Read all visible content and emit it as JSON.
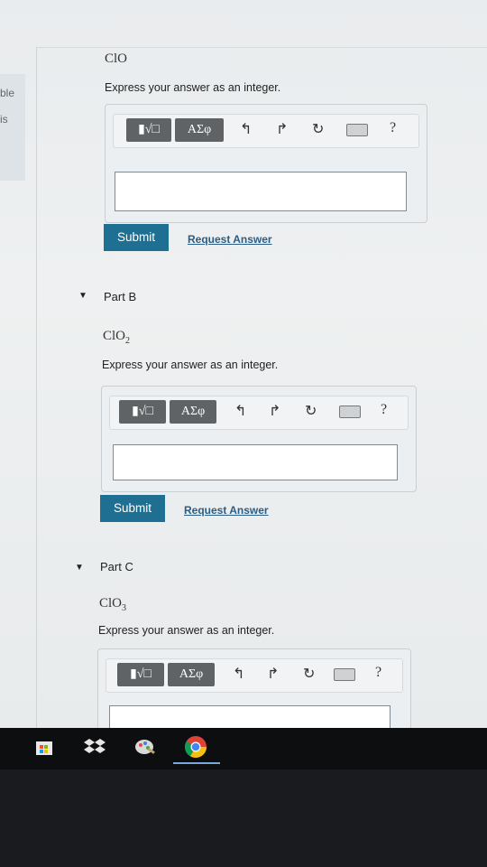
{
  "sidebar": {
    "text1": "ble",
    "text2": "is"
  },
  "parts": [
    {
      "id": "A",
      "title": "",
      "formula_main": "ClO",
      "formula_sub": "",
      "instruction": "Express your answer as an integer.",
      "submit_label": "Submit",
      "request_label": "Request Answer"
    },
    {
      "id": "B",
      "title": "Part B",
      "formula_main": "ClO",
      "formula_sub": "2",
      "instruction": "Express your answer as an integer.",
      "submit_label": "Submit",
      "request_label": "Request Answer"
    },
    {
      "id": "C",
      "title": "Part C",
      "formula_main": "ClO",
      "formula_sub": "3",
      "instruction": "Express your answer as an integer.",
      "submit_label": "",
      "request_label": ""
    }
  ],
  "toolbar": {
    "templates_icon": "fraction-sqrt-templates-icon",
    "greek_label": "ΑΣφ",
    "undo_icon": "undo-icon",
    "redo_icon": "redo-icon",
    "reset_icon": "reset-icon",
    "keyboard_icon": "keyboard-icon",
    "help_label": "?"
  },
  "taskbar": {
    "items": [
      "store-icon",
      "dropbox-icon",
      "paint-icon",
      "chrome-icon"
    ]
  },
  "colors": {
    "submit": "#1f6f93",
    "link": "#2b5d86",
    "toolbar_button": "#5f6366"
  }
}
